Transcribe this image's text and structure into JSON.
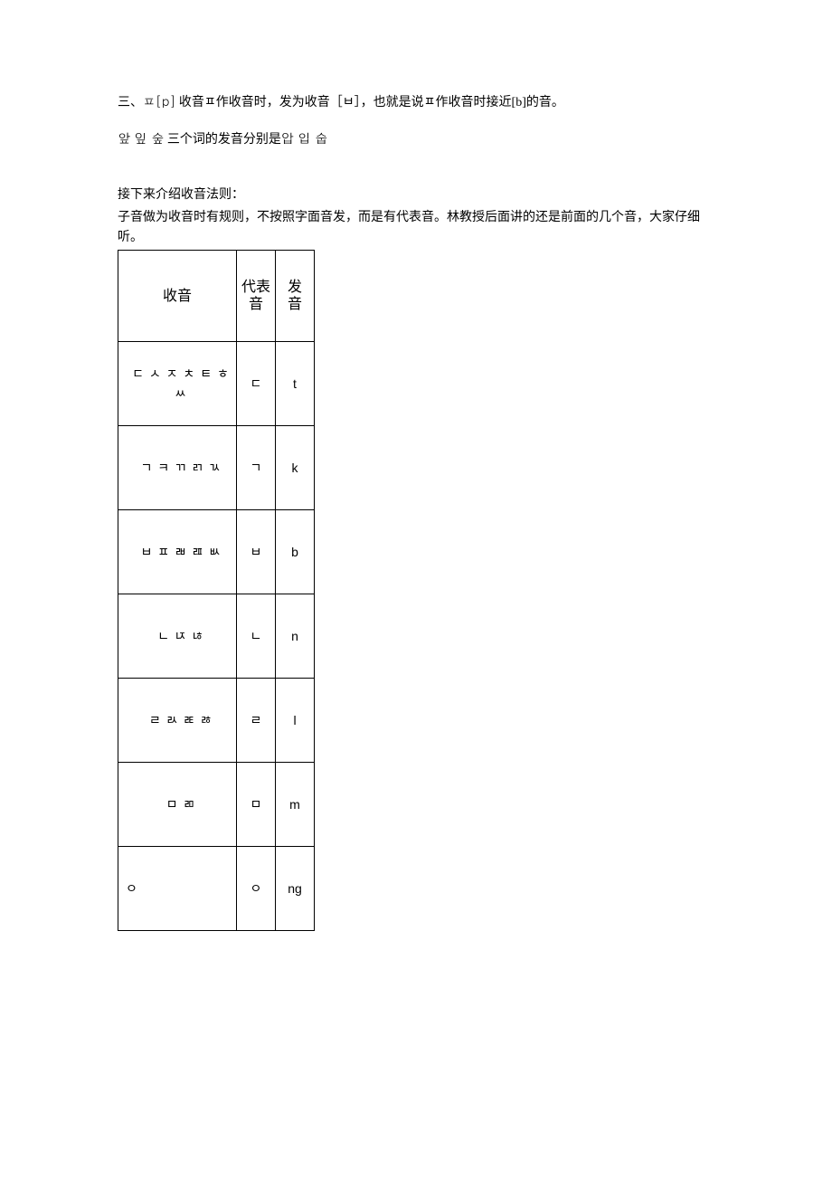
{
  "paragraphs": {
    "p1_a": "三、",
    "p1_b": "ㅍ[p]",
    "p1_c": "  收音ㅍ作收音时，发为收音［ㅂ］，也就是说ㅍ作收音时接近[b]的音。",
    "p2_a": "앞 잎 숲",
    "p2_b": " 三个词的发音分别是",
    "p2_c": "압 입 숩",
    "p3": "接下来介绍收音法则：",
    "p4": "子音做为收音时有规则，不按照字面音发，而是有代表音。林教授后面讲的还是前面的几个音，大家仔细听。"
  },
  "table": {
    "headers": {
      "col1": "收音",
      "col2": "代表\n音",
      "col3": "发\n音"
    },
    "rows": [
      {
        "batchim": "ㄷ ㅅ ㅈ ㅊ ㅌ ㅎ ㅆ",
        "rep": "ㄷ",
        "sound": "t"
      },
      {
        "batchim": "ㄱ ㅋ ㄲ ㄺ ㄳ",
        "rep": "ㄱ",
        "sound": "k"
      },
      {
        "batchim": "ㅂ ㅍ ㄼ ㄿ ㅄ",
        "rep": "ㅂ",
        "sound": "b"
      },
      {
        "batchim": "ㄴ ㄵ ㄶ",
        "rep": "ㄴ",
        "sound": "n"
      },
      {
        "batchim": "ㄹ ㄽ ㄾ ㅀ",
        "rep": "ㄹ",
        "sound": "l"
      },
      {
        "batchim": "ㅁ ㄻ",
        "rep": "ㅁ",
        "sound": "m"
      },
      {
        "batchim": "ㅇ",
        "rep": "ㅇ",
        "sound": "ng"
      }
    ]
  }
}
